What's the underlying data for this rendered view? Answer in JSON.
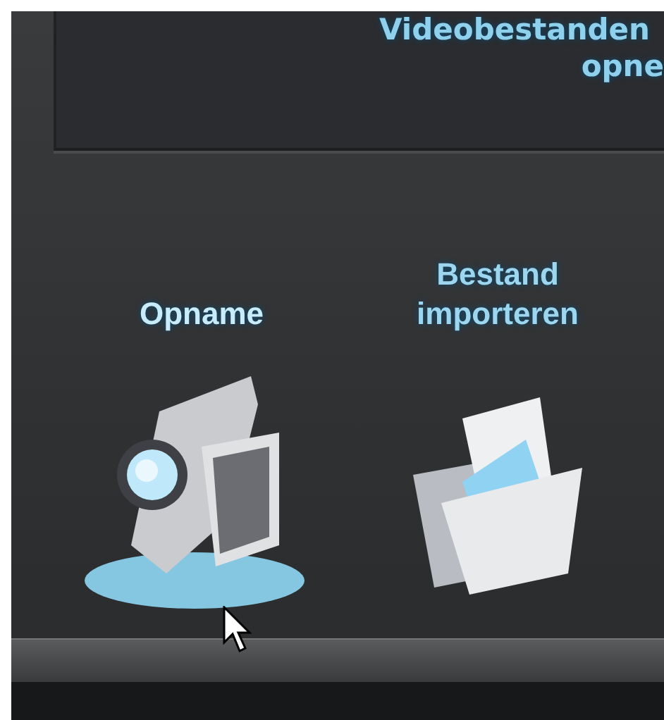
{
  "header_panel": {
    "title_lines": [
      "Videobestanden",
      "opne"
    ]
  },
  "options": [
    {
      "kind": "camera",
      "label_lines": [
        "Opname"
      ],
      "selected": true
    },
    {
      "kind": "folder",
      "label_lines": [
        "Bestand",
        "importeren"
      ],
      "selected": false
    }
  ]
}
